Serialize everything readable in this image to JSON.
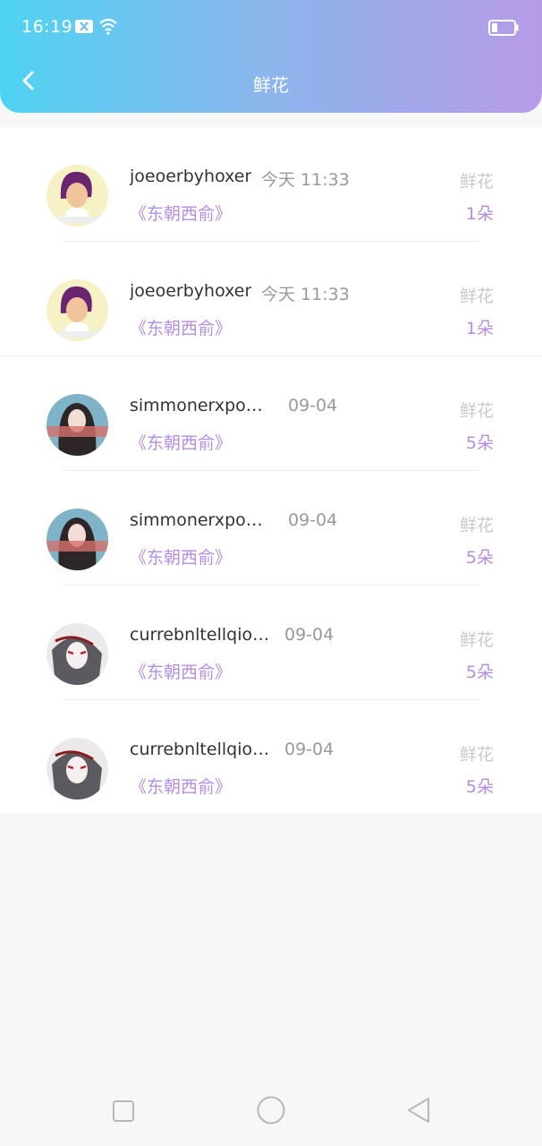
{
  "status": {
    "time": "16:19"
  },
  "header": {
    "title": "鲜花"
  },
  "rows": [
    {
      "name": "joeoerbyhoxer",
      "time": "今天 11:33",
      "book": "《东朝西俞》",
      "gift": "鲜花",
      "count": "1朵"
    },
    {
      "name": "joeoerbyhoxer",
      "time": "今天 11:33",
      "book": "《东朝西俞》",
      "gift": "鲜花",
      "count": "1朵"
    },
    {
      "name": "simmonerxpoc...",
      "time": "09-04",
      "book": "《东朝西俞》",
      "gift": "鲜花",
      "count": "5朵"
    },
    {
      "name": "simmonerxpoc...",
      "time": "09-04",
      "book": "《东朝西俞》",
      "gift": "鲜花",
      "count": "5朵"
    },
    {
      "name": "currebnltellqiottu",
      "time": "09-04",
      "book": "《东朝西俞》",
      "gift": "鲜花",
      "count": "5朵"
    },
    {
      "name": "currebnltellqiottu",
      "time": "09-04",
      "book": "《东朝西俞》",
      "gift": "鲜花",
      "count": "5朵"
    }
  ],
  "icons": {
    "back": "chevron-left-icon",
    "wifi": "wifi-icon",
    "battery": "battery-icon",
    "nav_recent": "square-icon",
    "nav_home": "circle-icon",
    "nav_back": "triangle-back-icon"
  },
  "colors": {
    "accent": "#b58ee3",
    "gradient_start": "#4fd3f2",
    "gradient_end": "#b79ae8"
  }
}
